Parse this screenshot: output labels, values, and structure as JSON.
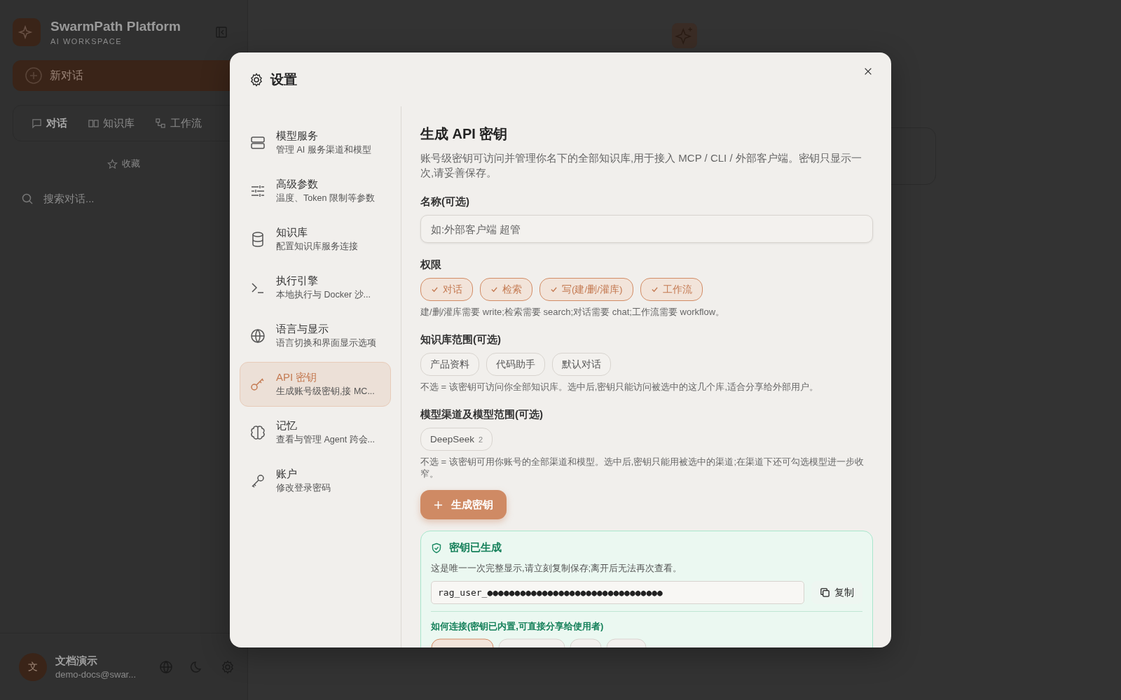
{
  "app": {
    "brand": "SwarmPath Platform",
    "subtitle": "AI WORKSPACE",
    "new_chat": "新对话",
    "tabs": [
      {
        "label": "对话",
        "selected": true
      },
      {
        "label": "知识库",
        "selected": false
      },
      {
        "label": "工作流",
        "selected": false
      }
    ],
    "favorites": "收藏",
    "search_placeholder": "搜索对话...",
    "user": {
      "avatar": "文",
      "name": "文档演示",
      "email": "demo-docs@swar..."
    }
  },
  "settings": {
    "title": "设置",
    "nav": [
      {
        "title": "模型服务",
        "subtitle": "管理 AI 服务渠道和模型",
        "selected": false
      },
      {
        "title": "高级参数",
        "subtitle": "温度、Token 限制等参数",
        "selected": false
      },
      {
        "title": "知识库",
        "subtitle": "配置知识库服务连接",
        "selected": false
      },
      {
        "title": "执行引擎",
        "subtitle": "本地执行与 Docker 沙...",
        "selected": false
      },
      {
        "title": "语言与显示",
        "subtitle": "语言切换和界面显示选项",
        "selected": false
      },
      {
        "title": "API 密钥",
        "subtitle": "生成账号级密钥,接 MC...",
        "selected": true
      },
      {
        "title": "记忆",
        "subtitle": "查看与管理 Agent 跨会...",
        "selected": false
      },
      {
        "title": "账户",
        "subtitle": "修改登录密码",
        "selected": false
      }
    ],
    "page": {
      "title": "生成 API 密钥",
      "description": "账号级密钥可访问并管理你名下的全部知识库,用于接入 MCP / CLI / 外部客户端。密钥只显示一次,请妥善保存。",
      "name_label": "名称(可选)",
      "name_placeholder": "如:外部客户端 超管",
      "permissions_label": "权限",
      "permissions": [
        {
          "label": "对话",
          "checked": true
        },
        {
          "label": "检索",
          "checked": true
        },
        {
          "label": "写(建/删/灌库)",
          "checked": true
        },
        {
          "label": "工作流",
          "checked": true
        }
      ],
      "permissions_hint": "建/删/灌库需要 write;检索需要 search;对话需要 chat;工作流需要 workflow。",
      "kb_label": "知识库范围(可选)",
      "kb": [
        {
          "label": "产品资料",
          "selected": false
        },
        {
          "label": "代码助手",
          "selected": false
        },
        {
          "label": "默认对话",
          "selected": false
        }
      ],
      "kb_hint": "不选 = 该密钥可访问你全部知识库。选中后,密钥只能访问被选中的这几个库,适合分享给外部用户。",
      "channels_label": "模型渠道及模型范围(可选)",
      "channels": [
        {
          "label": "DeepSeek",
          "count": "2",
          "selected": false
        }
      ],
      "channels_hint": "不选 = 该密钥可用你账号的全部渠道和模型。选中后,密钥只能用被选中的渠道;在渠道下还可勾选模型进一步收窄。",
      "generate_button": "生成密钥",
      "result": {
        "title": "密钥已生成",
        "notice": "这是唯一一次完整显示,请立刻复制保存;离开后无法再次查看。",
        "key": "rag_user_●●●●●●●●●●●●●●●●●●●●●●●●●●●●●●●●",
        "copy": "复制",
        "connect_label": "如何连接(密钥已内置,可直接分享给使用者)"
      }
    }
  }
}
